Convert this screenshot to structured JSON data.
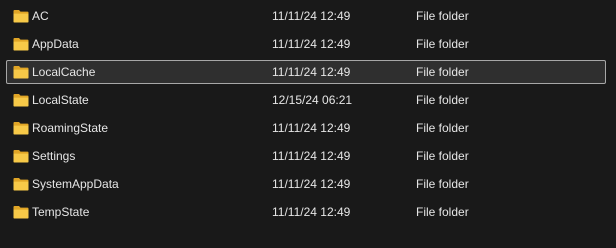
{
  "folder_icon_color": "#f7c948",
  "rows": [
    {
      "name": "AC",
      "date": "11/11/24 12:49",
      "type": "File folder",
      "icon": "folder-icon",
      "selected": false
    },
    {
      "name": "AppData",
      "date": "11/11/24 12:49",
      "type": "File folder",
      "icon": "folder-icon",
      "selected": false
    },
    {
      "name": "LocalCache",
      "date": "11/11/24 12:49",
      "type": "File folder",
      "icon": "folder-icon",
      "selected": true
    },
    {
      "name": "LocalState",
      "date": "12/15/24 06:21",
      "type": "File folder",
      "icon": "folder-icon",
      "selected": false
    },
    {
      "name": "RoamingState",
      "date": "11/11/24 12:49",
      "type": "File folder",
      "icon": "folder-icon",
      "selected": false
    },
    {
      "name": "Settings",
      "date": "11/11/24 12:49",
      "type": "File folder",
      "icon": "folder-icon",
      "selected": false
    },
    {
      "name": "SystemAppData",
      "date": "11/11/24 12:49",
      "type": "File folder",
      "icon": "folder-icon",
      "selected": false
    },
    {
      "name": "TempState",
      "date": "11/11/24 12:49",
      "type": "File folder",
      "icon": "folder-icon",
      "selected": false
    }
  ]
}
